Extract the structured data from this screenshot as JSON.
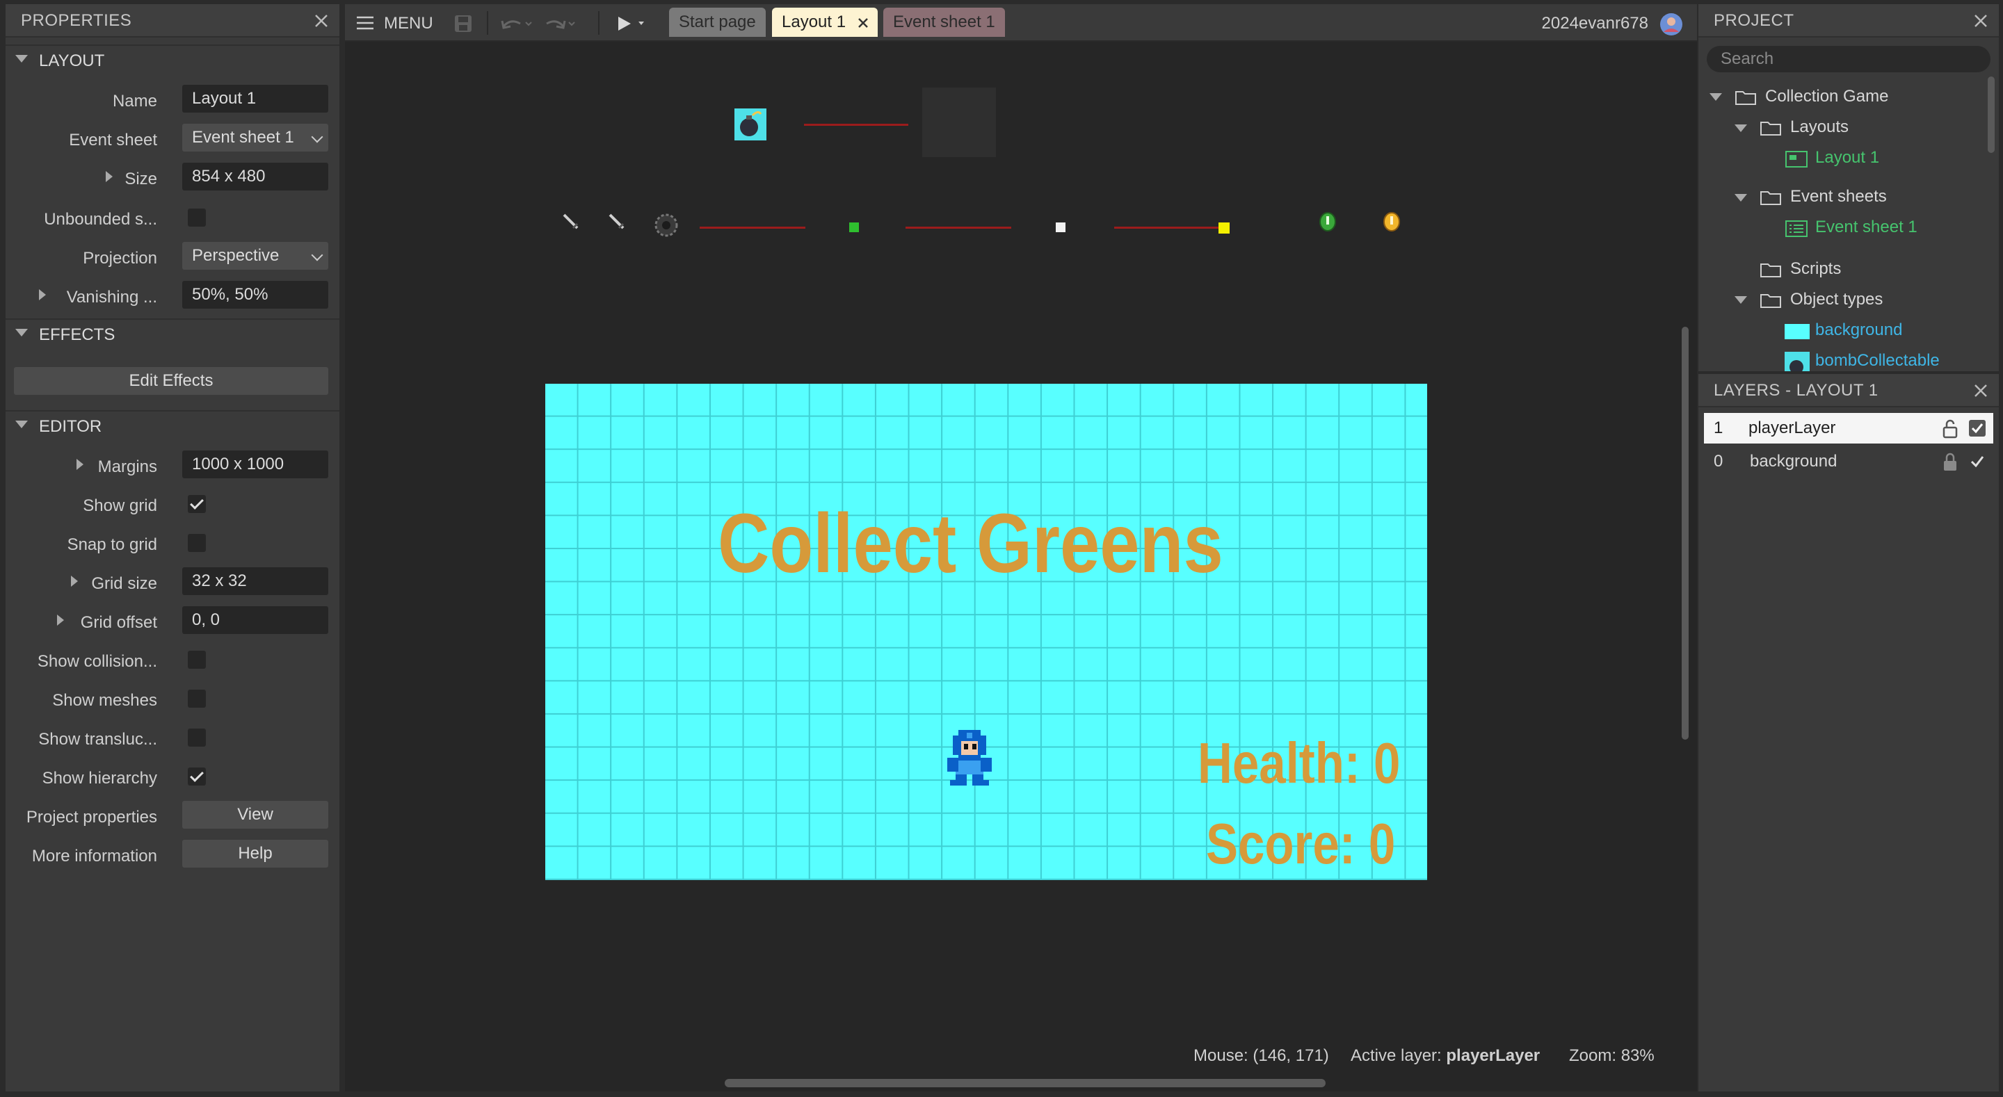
{
  "properties": {
    "title": "PROPERTIES",
    "layout_section": "LAYOUT",
    "name_label": "Name",
    "name_value": "Layout 1",
    "event_sheet_label": "Event sheet",
    "event_sheet_value": "Event sheet 1",
    "size_label": "Size",
    "size_value": "854 x 480",
    "unbounded_label": "Unbounded s...",
    "unbounded_checked": false,
    "projection_label": "Projection",
    "projection_value": "Perspective",
    "vanishing_label": "Vanishing ...",
    "vanishing_value": "50%, 50%",
    "effects_section": "EFFECTS",
    "edit_effects_label": "Edit Effects",
    "editor_section": "EDITOR",
    "margins_label": "Margins",
    "margins_value": "1000 x 1000",
    "show_grid_label": "Show grid",
    "show_grid_checked": true,
    "snap_label": "Snap to grid",
    "snap_checked": false,
    "grid_size_label": "Grid size",
    "grid_size_value": "32 x 32",
    "grid_offset_label": "Grid offset",
    "grid_offset_value": "0, 0",
    "show_collision_label": "Show collision...",
    "show_collision_checked": false,
    "show_meshes_label": "Show meshes",
    "show_meshes_checked": false,
    "show_transluc_label": "Show transluc...",
    "show_transluc_checked": false,
    "show_hierarchy_label": "Show hierarchy",
    "show_hierarchy_checked": true,
    "project_props_label": "Project properties",
    "project_props_button": "View",
    "more_info_label": "More information",
    "more_info_button": "Help"
  },
  "toolbar": {
    "menu_label": "MENU",
    "tabs": [
      {
        "label": "Start page",
        "color": "#7a7a7a"
      },
      {
        "label": "Layout 1",
        "color": "#fdf3d2",
        "active": true
      },
      {
        "label": "Event sheet 1",
        "color": "#8b6f74"
      }
    ],
    "username": "2024evanr678"
  },
  "canvas": {
    "title_text": "Collect Greens",
    "health_text": "Health: 0",
    "score_text": "Score: 0",
    "bg_color": "#58ffff",
    "text_color": "#d69a3a"
  },
  "status": {
    "mouse_label": "Mouse:",
    "mouse_value": "(146, 171)",
    "active_layer_label": "Active layer:",
    "active_layer_value": "playerLayer",
    "zoom_label": "Zoom:",
    "zoom_value": "83%"
  },
  "project": {
    "title": "PROJECT",
    "search_placeholder": "Search",
    "root": "Collection Game",
    "layouts_folder": "Layouts",
    "layout_item": "Layout 1",
    "event_sheets_folder": "Event sheets",
    "event_sheet_item": "Event sheet 1",
    "scripts_folder": "Scripts",
    "object_types_folder": "Object types",
    "object_items": [
      "background",
      "bombCollectable"
    ]
  },
  "layers": {
    "title": "LAYERS - LAYOUT 1",
    "rows": [
      {
        "index": "1",
        "name": "playerLayer",
        "locked": false,
        "visible": true,
        "selected": true
      },
      {
        "index": "0",
        "name": "background",
        "locked": true,
        "visible": true,
        "selected": false
      }
    ]
  },
  "icons": [
    "close-icon",
    "menu-icon",
    "save-icon",
    "undo-icon",
    "redo-icon",
    "play-icon",
    "user-avatar-icon",
    "folder-icon",
    "layout-icon",
    "event-sheet-icon",
    "lock-icon",
    "unlock-icon",
    "checkbox-icon"
  ],
  "colors": {
    "accent_green": "#46c46e",
    "object_blue": "#3fb6e6",
    "panel": "#3a3a3a",
    "editor_bg": "#262626"
  }
}
